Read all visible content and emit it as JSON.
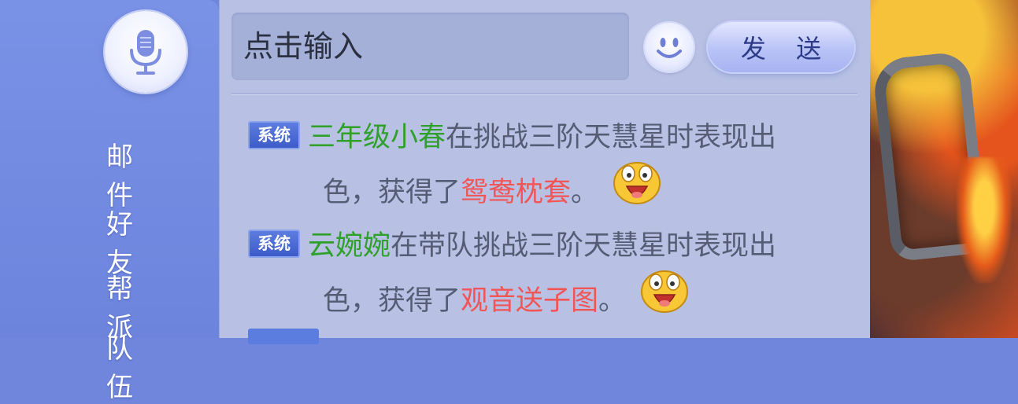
{
  "sidebar": {
    "items": [
      {
        "label": "邮 件"
      },
      {
        "label": "好 友"
      },
      {
        "label": "帮 派"
      },
      {
        "label": "队 伍"
      }
    ]
  },
  "chat": {
    "input_placeholder": "点击输入",
    "send_label": "发 送",
    "messages": [
      {
        "tag": "系统",
        "name": "三年级小春",
        "text1": "在挑战三阶天慧星时表现出",
        "text2_prefix": "色，获得了",
        "item": "鸳鸯枕套",
        "text2_suffix": "。",
        "emoji": "happy-face-icon"
      },
      {
        "tag": "系统",
        "name": "云婉婉",
        "text1": "在带队挑战三阶天慧星时表现出",
        "text2_prefix": "色，获得了",
        "item": "观音送子图",
        "text2_suffix": "。",
        "emoji": "happy-face-icon"
      }
    ]
  },
  "colors": {
    "sidebar": "#6f86dc",
    "panel": "#b8c1e4",
    "player_name": "#2fa12a",
    "item_name": "#f25555",
    "tag_bg": "#4a67d2"
  }
}
